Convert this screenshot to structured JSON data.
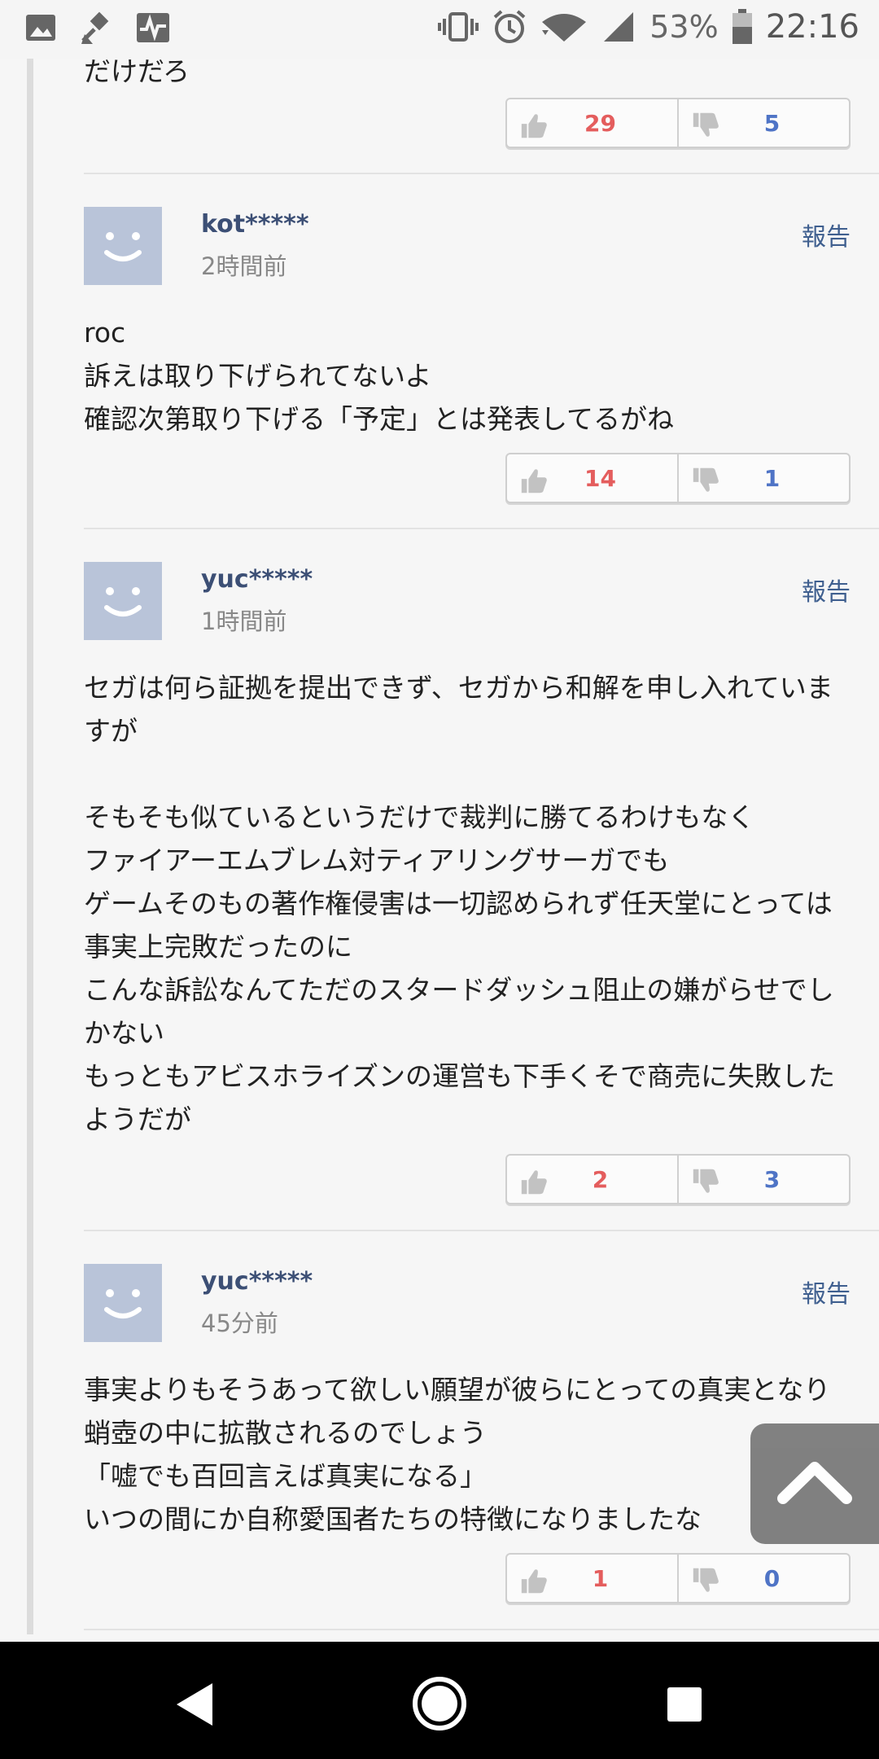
{
  "status_bar": {
    "battery": "53%",
    "time": "22:16"
  },
  "previous_comment": {
    "text_tail": "だけだろ",
    "good": "29",
    "bad": "5"
  },
  "comments": [
    {
      "user": "kot*****",
      "time": "2時間前",
      "report": "報告",
      "body": "roc\n訴えは取り下げられてないよ\n確認次第取り下げる「予定」とは発表してるがね",
      "good": "14",
      "bad": "1"
    },
    {
      "user": "yuc*****",
      "time": "1時間前",
      "report": "報告",
      "body": "セガは何ら証拠を提出できず、セガから和解を申し入れていますが\n\nそもそも似ているというだけで裁判に勝てるわけもなく\nファイアーエムブレム対ティアリングサーガでも\nゲームそのもの著作権侵害は一切認められず任天堂にとっては事実上完敗だったのに\nこんな訴訟なんてただのスタードダッシュ阻止の嫌がらせでしかない\nもっともアビスホライズンの運営も下手くそで商売に失敗したようだが",
      "good": "2",
      "bad": "3"
    },
    {
      "user": "yuc*****",
      "time": "45分前",
      "report": "報告",
      "body": "事実よりもそうあって欲しい願望が彼らにとっての真実となり蛸壺の中に拡散されるのでしょう\n「嘘でも百回言えば真実になる」\nいつの間にか自称愛国者たちの特徴になりましたな",
      "good": "1",
      "bad": "0"
    }
  ],
  "colors": {
    "good": "#e45d5d",
    "bad": "#4f74c6",
    "username": "#3c4f75"
  }
}
